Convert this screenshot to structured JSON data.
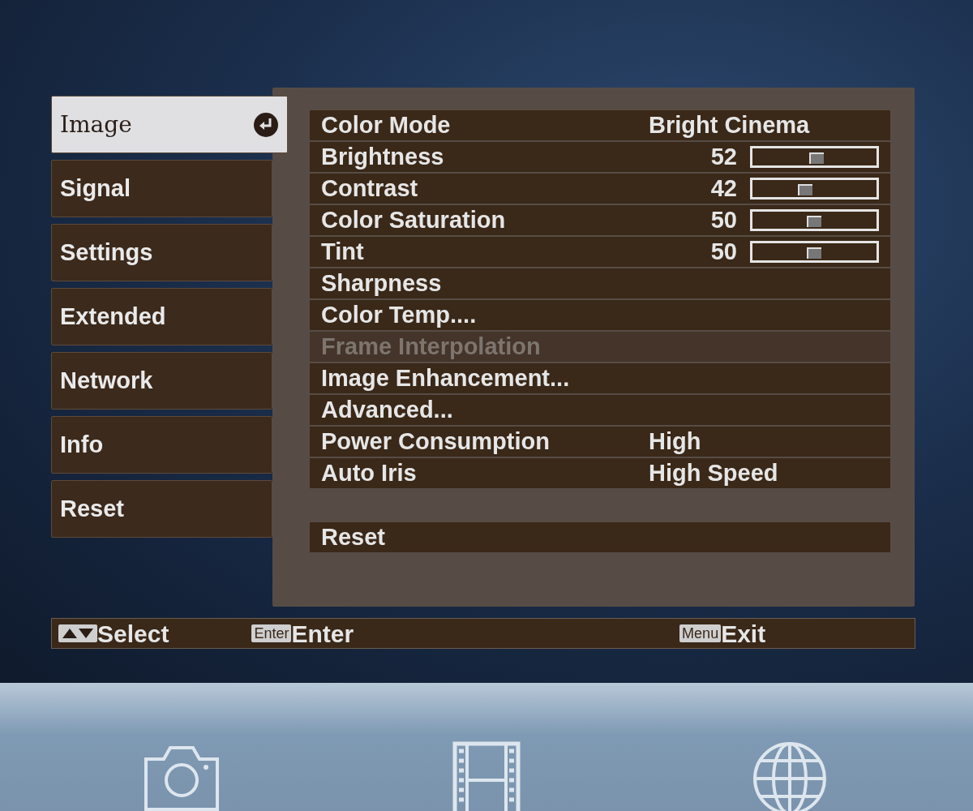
{
  "sidebar": {
    "items": [
      {
        "label": "Image",
        "selected": true
      },
      {
        "label": "Signal",
        "selected": false
      },
      {
        "label": "Settings",
        "selected": false
      },
      {
        "label": "Extended",
        "selected": false
      },
      {
        "label": "Network",
        "selected": false
      },
      {
        "label": "Info",
        "selected": false
      },
      {
        "label": "Reset",
        "selected": false
      }
    ]
  },
  "settings": [
    {
      "kind": "value",
      "label": "Color Mode",
      "value": "Bright Cinema",
      "disabled": false
    },
    {
      "kind": "slider",
      "label": "Brightness",
      "value": "52",
      "level": 0.52,
      "disabled": false
    },
    {
      "kind": "slider",
      "label": "Contrast",
      "value": "42",
      "level": 0.42,
      "disabled": false
    },
    {
      "kind": "slider",
      "label": "Color Saturation",
      "value": "50",
      "level": 0.5,
      "disabled": false
    },
    {
      "kind": "slider",
      "label": "Tint",
      "value": "50",
      "level": 0.5,
      "disabled": false
    },
    {
      "kind": "plain",
      "label": "Sharpness",
      "disabled": false
    },
    {
      "kind": "plain",
      "label": "Color Temp....",
      "disabled": false
    },
    {
      "kind": "plain",
      "label": "Frame Interpolation",
      "disabled": true
    },
    {
      "kind": "plain",
      "label": "Image Enhancement...",
      "disabled": false
    },
    {
      "kind": "plain",
      "label": "Advanced...",
      "disabled": false
    },
    {
      "kind": "value",
      "label": "Power Consumption",
      "value": "High",
      "disabled": false
    },
    {
      "kind": "value",
      "label": "Auto Iris",
      "value": "High Speed",
      "disabled": false
    }
  ],
  "reset": {
    "label": "Reset"
  },
  "footer": [
    {
      "kind": "arrows",
      "label": "Select"
    },
    {
      "kind": "key",
      "key": "Enter",
      "label": "Enter"
    },
    {
      "kind": "key",
      "key": "Menu",
      "label": "Exit"
    }
  ],
  "dock_icons": [
    {
      "kind": "camera"
    },
    {
      "kind": "film"
    },
    {
      "kind": "globe"
    }
  ]
}
